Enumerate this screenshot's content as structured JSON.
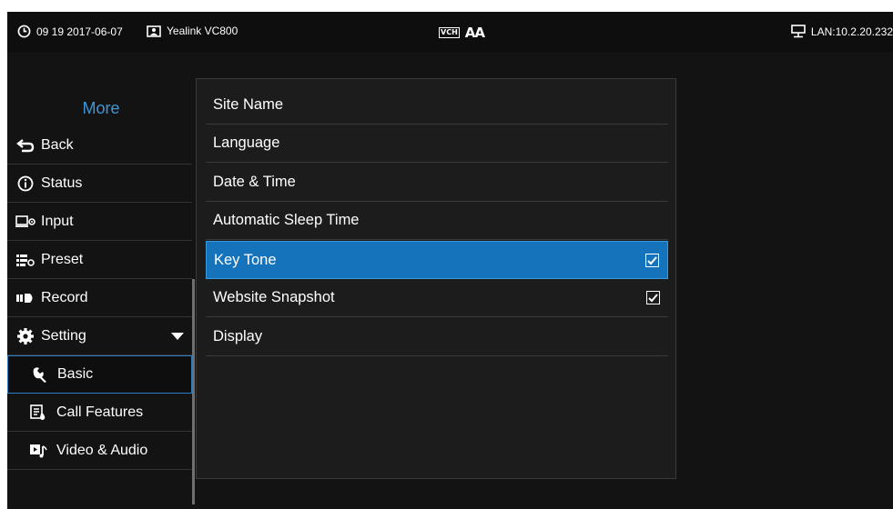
{
  "status_bar": {
    "datetime": "09 19 2017-06-07",
    "device_name": "Yealink VC800",
    "vch_label": "VCH",
    "font_size_label": "AA",
    "lan": "LAN:10.2.20.232"
  },
  "sidebar": {
    "title": "More",
    "items": [
      {
        "label": "Back",
        "icon": "back-arrow-icon"
      },
      {
        "label": "Status",
        "icon": "info-icon"
      },
      {
        "label": "Input",
        "icon": "input-icon"
      },
      {
        "label": "Preset",
        "icon": "preset-icon"
      },
      {
        "label": "Record",
        "icon": "record-icon"
      },
      {
        "label": "Setting",
        "icon": "gear-icon",
        "expanded": true
      },
      {
        "label": "Basic",
        "icon": "wrench-icon",
        "selected": true
      },
      {
        "label": "Call Features",
        "icon": "call-features-icon"
      },
      {
        "label": "Video & Audio",
        "icon": "video-audio-icon"
      }
    ]
  },
  "settings": {
    "items": [
      {
        "label": "Site Name"
      },
      {
        "label": "Language"
      },
      {
        "label": "Date & Time"
      },
      {
        "label": "Automatic Sleep Time"
      },
      {
        "label": "Key Tone",
        "checked": true,
        "selected": true
      },
      {
        "label": "Website Snapshot",
        "checked": true
      },
      {
        "label": "Display"
      }
    ]
  },
  "colors": {
    "accent": "#1573bb",
    "title_blue": "#3f96d6",
    "background": "#131313"
  }
}
